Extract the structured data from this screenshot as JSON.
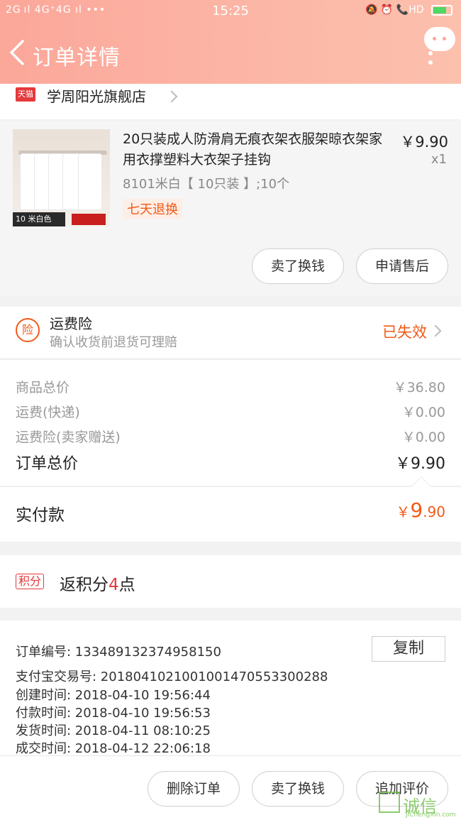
{
  "status_bar": {
    "left_text": "2G ıl 4G⁺4G ıl •••",
    "time": "15:25",
    "right_text": "🔕 ⏰ 📞HD",
    "battery_level": 0.7
  },
  "header": {
    "title": "订单详情"
  },
  "shop": {
    "badge": "天猫",
    "name": "学周阳光旗舰店"
  },
  "product": {
    "name": "20只装成人防滑肩无痕衣架衣服架晾衣架家用衣撑塑料大衣架子挂钩",
    "price": "￥9.90",
    "qty": "x1",
    "spec": "8101米白【 10只装 】;10个",
    "return_badge": "七天退换",
    "thumb_tag": "10 米白色",
    "btn_sell": "卖了换钱",
    "btn_after_sale": "申请售后"
  },
  "insurance": {
    "icon": "险",
    "title": "运费险",
    "subtitle": "确认收货前退货可理赔",
    "status": "已失效"
  },
  "prices": {
    "rows": [
      {
        "label": "商品总价",
        "value": "￥36.80"
      },
      {
        "label": "运费(快递)",
        "value": "￥0.00"
      },
      {
        "label": "运费险(卖家赠送)",
        "value": "￥0.00"
      }
    ],
    "total_label": "订单总价",
    "total_value": "￥9.90"
  },
  "paid": {
    "label": "实付款",
    "symbol": "￥",
    "integer": "9",
    "decimal": ".90"
  },
  "points": {
    "tag": "积分",
    "prefix": "返积分",
    "num": "4",
    "suffix": "点"
  },
  "order_info": {
    "copy_label": "复制",
    "rows": [
      "订单编号:   133489132374958150",
      "支付宝交易号:   2018041021001001470553300288",
      "创建时间:   2018-04-10  19:56:44",
      "付款时间:   2018-04-10  19:56:53",
      "发货时间:   2018-04-11  08:10:25",
      "成交时间:   2018-04-12  22:06:18"
    ]
  },
  "bottom_bar": {
    "btn_delete": "删除订单",
    "btn_sell": "卖了换钱",
    "btn_review": "追加评价"
  },
  "watermark": {
    "text": "诚信",
    "url": "JiChengXin.com"
  },
  "colors": {
    "accent": "#f25a17",
    "header": "#fba79a",
    "red": "#e4393c"
  }
}
